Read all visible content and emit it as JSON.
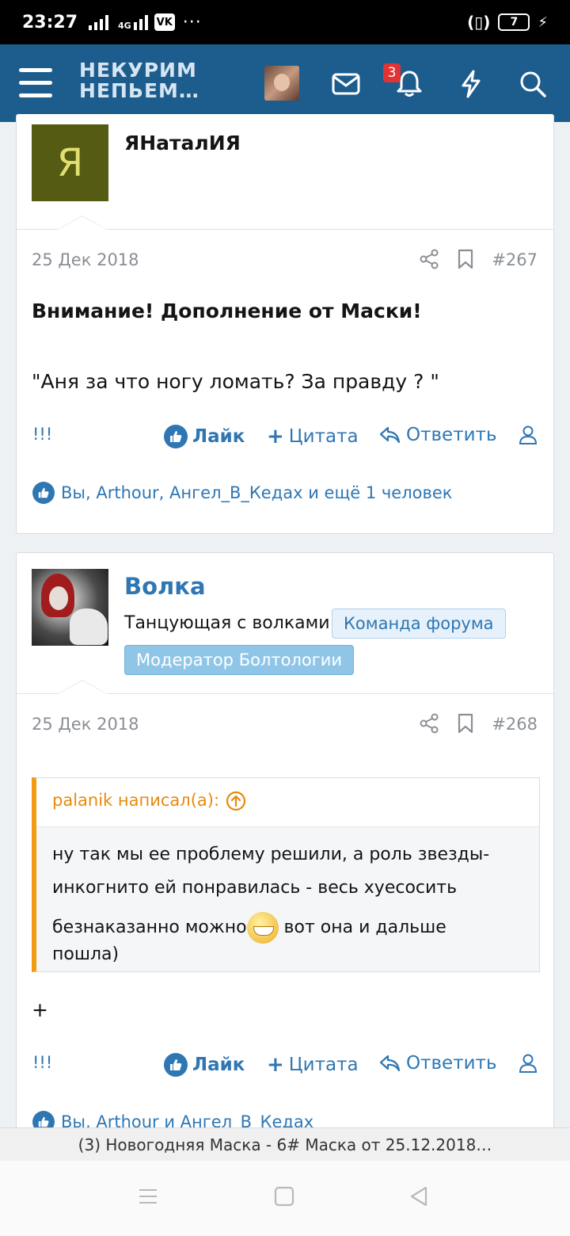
{
  "status_bar": {
    "time": "23:27",
    "network": "4G",
    "notif_app": "VK",
    "more": "···",
    "vibrate": "(▯)",
    "battery": "7"
  },
  "header": {
    "logo_line1": "НЕКУРИМ",
    "logo_line2": "НЕПЬЕМ…",
    "alerts_badge": "3",
    "icons": [
      "menu-icon",
      "mail-icon",
      "bell-icon",
      "lightning-icon",
      "search-icon"
    ],
    "brand_color": "#1d5d8e"
  },
  "posts": [
    {
      "avatar_letter": "Я",
      "username": "ЯНаталИЯ",
      "date": "25 Дек 2018",
      "number": "#267",
      "line1": "Внимание! Дополнение от Маски!",
      "line2": "\"Аня за что ногу ломать? За правду ? \"",
      "likers": "Вы, Arthour, Ангел_В_Кедах и ещё 1 человек"
    },
    {
      "username": "Волка",
      "user_title": "Танцующая с волками",
      "tag_team": "Команда форума",
      "tag_mod": "Модератор Болтологии",
      "date": "25 Дек 2018",
      "number": "#268",
      "quote_author": "palanik написал(а):",
      "quote_l1": "ну так мы ее проблему решили, а роль звезды-",
      "quote_l2": "инкогнито ей понравилась - весь хуесосить",
      "quote_l3a": "безнаказанно можно",
      "quote_l3b": " вот она и дальше",
      "quote_l4": "пошла)",
      "reply": "+",
      "likers": "Вы, Arthour и Ангел_В_Кедах"
    }
  ],
  "actions": {
    "report": "!!!",
    "like": "Лайк",
    "quote": "Цитата",
    "reply": "Ответить"
  },
  "tab_title": "(3) Новогодняя Маска - 6# Маска от 25.12.2018…"
}
